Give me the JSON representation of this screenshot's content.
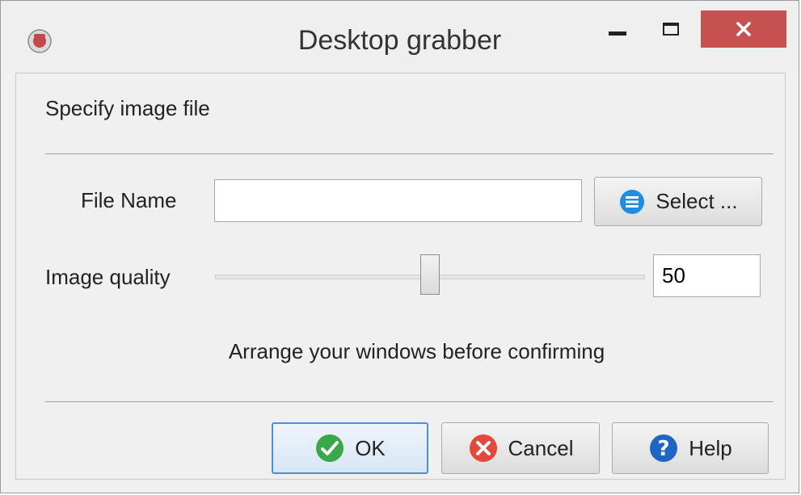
{
  "window": {
    "title": "Desktop grabber",
    "close_glyph": "✕",
    "icons": {
      "app": "app-icon",
      "minimize": "minimize-icon",
      "maximize": "maximize-icon",
      "close": "close-icon"
    }
  },
  "heading": "Specify image file",
  "file_name": {
    "label": "File Name",
    "value": "",
    "placeholder": ""
  },
  "select_button": {
    "label": "Select ...",
    "icon": "list-icon"
  },
  "quality": {
    "label": "Image quality",
    "value": "50",
    "slider_fraction": 0.5
  },
  "hint": "Arrange your windows before confirming",
  "buttons": {
    "ok": {
      "label": "OK",
      "icon": "check-icon"
    },
    "cancel": {
      "label": "Cancel",
      "icon": "cancel-icon"
    },
    "help": {
      "label": "Help",
      "icon": "help-icon"
    }
  },
  "colors": {
    "close_button": "#c75050",
    "default_border": "#4a90d9",
    "ok_icon": "#3aa74a",
    "cancel_icon": "#e2493b",
    "help_icon": "#1f66c4",
    "select_icon": "#1e8fe0"
  }
}
